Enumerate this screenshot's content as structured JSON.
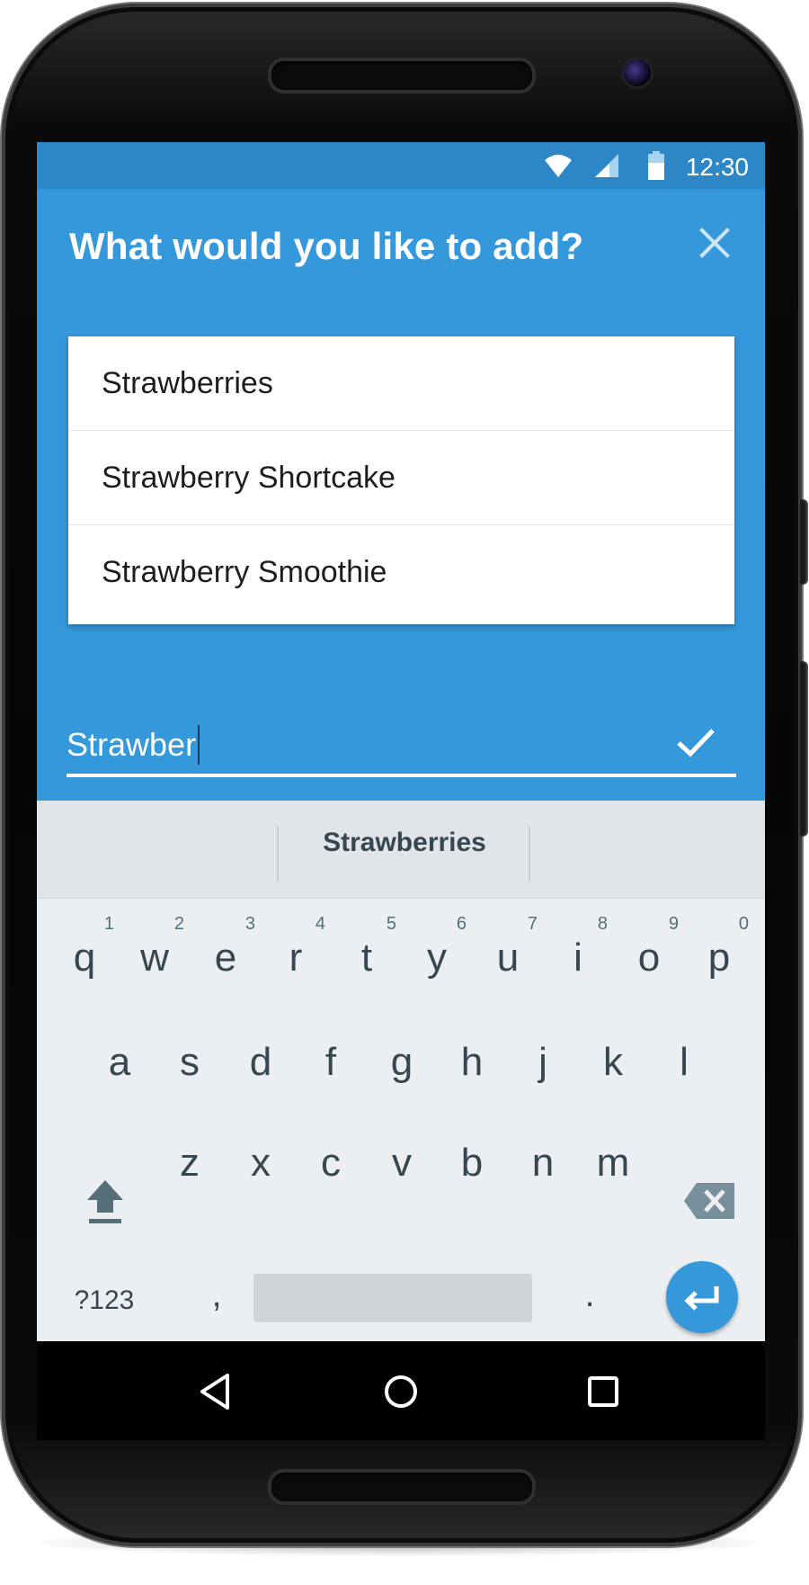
{
  "status_bar": {
    "time": "12:30",
    "icons": [
      "wifi-icon",
      "signal-icon",
      "battery-icon"
    ]
  },
  "dialog": {
    "title": "What would you like to add?",
    "close_icon": "close-icon"
  },
  "suggestions": [
    {
      "label": "Strawberries"
    },
    {
      "label": "Strawberry Shortcake"
    },
    {
      "label": "Strawberry Smoothie"
    }
  ],
  "input": {
    "value": "Strawber",
    "confirm_icon": "check-icon"
  },
  "keyboard": {
    "suggestion_strip": {
      "center_word": "Strawberries"
    },
    "row1": [
      {
        "key": "q",
        "hint": "1"
      },
      {
        "key": "w",
        "hint": "2"
      },
      {
        "key": "e",
        "hint": "3"
      },
      {
        "key": "r",
        "hint": "4"
      },
      {
        "key": "t",
        "hint": "5"
      },
      {
        "key": "y",
        "hint": "6"
      },
      {
        "key": "u",
        "hint": "7"
      },
      {
        "key": "i",
        "hint": "8"
      },
      {
        "key": "o",
        "hint": "9"
      },
      {
        "key": "p",
        "hint": "0"
      }
    ],
    "row2": [
      "a",
      "s",
      "d",
      "f",
      "g",
      "h",
      "j",
      "k",
      "l"
    ],
    "row3": [
      "z",
      "x",
      "c",
      "v",
      "b",
      "n",
      "m"
    ],
    "bottom_row": {
      "symbols_label": "?123",
      "comma_label": ",",
      "period_label": "."
    }
  },
  "colors": {
    "app_bar": "#3498db",
    "status_bar": "#2d86c6",
    "keyboard_bg": "#eceff1",
    "key_text": "#37474f",
    "accent": "#3498db"
  }
}
